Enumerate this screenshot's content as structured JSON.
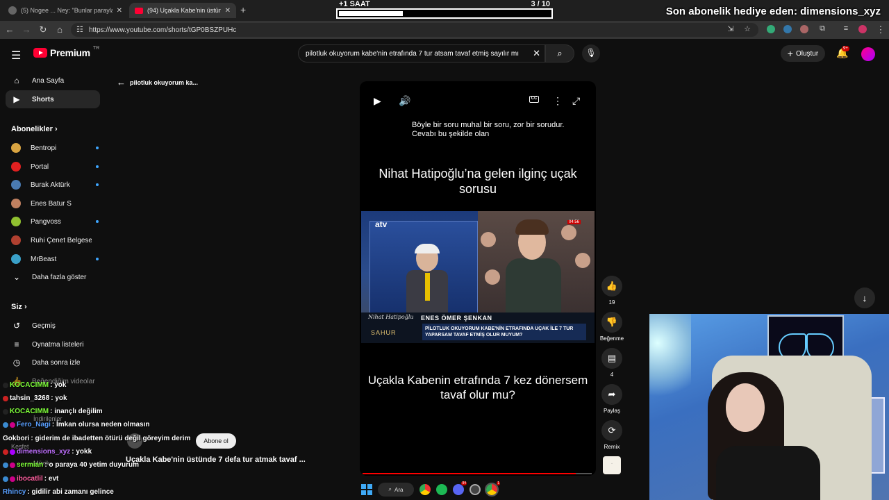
{
  "browser": {
    "tabs": [
      {
        "title": "(5) Nogee ... Ney: \"Bunlar parayla...\""
      },
      {
        "title": "(94) Uçakla Kabe'nin üstünde 7..."
      }
    ],
    "new_tab": "+",
    "url": "https://www.youtube.com/shorts/tGP0BSZPUHc"
  },
  "stream_overlay": {
    "timer_label": "+1 SAAT",
    "timer_count": "3   / 10",
    "timer_progress": 0.3,
    "sub_banner": "Son abonelik hediye eden: dimensions_xyz"
  },
  "youtube": {
    "logo_text": "Premium",
    "country": "TR",
    "search_query": "pilotluk okuyorum kabe'nin etrafında 7 tur atsam tavaf etmiş sayılır mı",
    "create_label": "Oluştur",
    "notification_count": "9+"
  },
  "sidebar": {
    "main": [
      {
        "label": "Ana Sayfa",
        "icon": "home-icon"
      },
      {
        "label": "Shorts",
        "icon": "shorts-icon"
      }
    ],
    "subs_title": "Abonelikler",
    "subscriptions": [
      {
        "label": "Bentropi",
        "color": "#d9a441"
      },
      {
        "label": "Portal",
        "color": "#e02020"
      },
      {
        "label": "Burak Aktürk",
        "color": "#4a7ab0"
      },
      {
        "label": "Enes Batur S",
        "color": "#c08060"
      },
      {
        "label": "Pangvoss",
        "color": "#90c030"
      },
      {
        "label": "Ruhi Çenet Belgese...",
        "color": "#b04030"
      },
      {
        "label": "MrBeast",
        "color": "#3aa0c8"
      }
    ],
    "show_more": "Daha fazla göster",
    "you_title": "Siz",
    "you_items": [
      {
        "label": "Geçmiş",
        "icon": "history-icon"
      },
      {
        "label": "Oynatma listeleri",
        "icon": "playlists-icon"
      },
      {
        "label": "Daha sonra izle",
        "icon": "watch-later-icon"
      },
      {
        "label": "Beğendiğim videolar",
        "icon": "like-icon"
      }
    ],
    "obscured": [
      "İndirilenler",
      "Keşfet",
      "Müzik"
    ]
  },
  "shorts": {
    "back_label": "pilotluk okuyorum ka...",
    "subtitle": "Böyle bir soru muhal bir soru, zor bir sorudur. Cevabı bu şekilde olan",
    "headline_top": "Nihat Hatipoğlu’na gelen ilginç uçak sorusu",
    "tv_logo": "atv",
    "tv_time": "04:56",
    "show_name": "Nihat Hatipoğlu",
    "show_sub": "SAHUR",
    "lower_name": "ENES ÖMER ŞENKAN",
    "lower_desc": "PİLOTLUK OKUYORUM KABE'NİN ETRAFINDA UÇAK İLE 7 TUR YAPARSAM TAVAF ETMİŞ OLUR MUYUM?",
    "headline_bottom": "Uçakla Kabenin etrafında 7 kez dönersem  tavaf olur mu?",
    "video_title": "Uçakla Kabe'nin üstünde 7 defa tur atmak tavaf ...",
    "subscribe_label": "Abone ol",
    "progress": 0.93,
    "actions": [
      {
        "label": "19",
        "icon": "like-icon"
      },
      {
        "label": "Beğenme",
        "icon": "dislike-icon"
      },
      {
        "label": "4",
        "icon": "comment-icon"
      },
      {
        "label": "Paylaş",
        "icon": "share-icon"
      },
      {
        "label": "Remix",
        "icon": "remix-icon"
      }
    ]
  },
  "chat": [
    {
      "user": "KOCACIMM",
      "msg": ": yok",
      "color": "#7fff3a"
    },
    {
      "user": "tahsin_3268",
      "msg": ": yok",
      "color": "#ffffff"
    },
    {
      "user": "KOCACIMM",
      "msg": ": inançlı değilim",
      "color": "#7fff3a"
    },
    {
      "user": "Fero_Nagi",
      "msg": ": İmkan olursa neden olmasın",
      "color": "#5aa0ff"
    },
    {
      "user": "Gokbori",
      "msg": ": giderim de ibadetten ötürü değil göreyim derim",
      "color": "#ffffff"
    },
    {
      "user": "dimensions_xyz",
      "msg": ": yokk",
      "color": "#c070ff"
    },
    {
      "user": "sermian",
      "msg": ": o paraya 40 yetim duyurum",
      "color": "#7fff3a"
    },
    {
      "user": "ibocatlil",
      "msg": ": evt",
      "color": "#ff60a0"
    },
    {
      "user": "Rhincy",
      "msg": ": gidilir abi zamanı gelince",
      "color": "#5aa0ff"
    }
  ],
  "taskbar": {
    "search_label": "Ara",
    "discord_badge": "94",
    "chrome_badge": "1"
  }
}
